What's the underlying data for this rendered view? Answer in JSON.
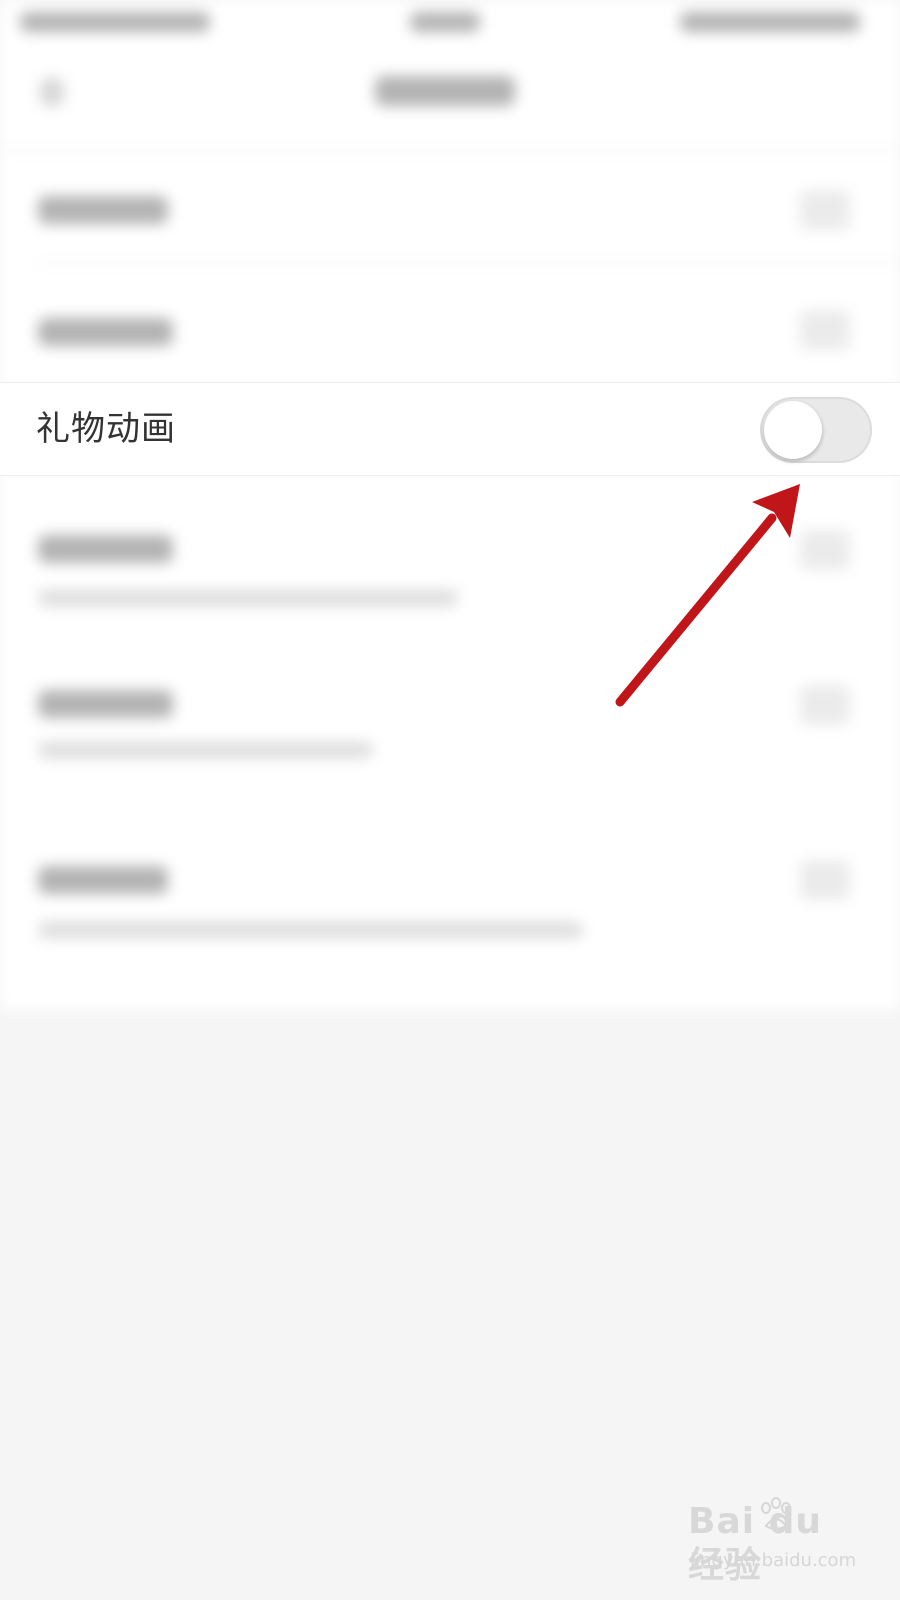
{
  "settings": {
    "highlighted_item": {
      "label": "礼物动画",
      "toggle_on": false
    }
  },
  "annotation": {
    "arrow_color": "#c0161a"
  },
  "watermark": {
    "logo_text": "Bai du 经验",
    "url_text": "jingyan.baidu.com"
  },
  "colors": {
    "background": "#f5f5f5",
    "row_background": "#ffffff",
    "toggle_off_track": "#e9e9e9"
  }
}
